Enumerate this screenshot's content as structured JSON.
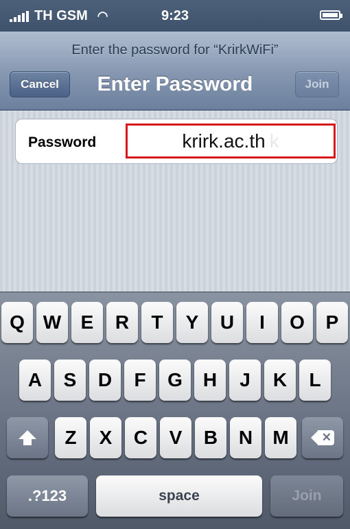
{
  "status_bar": {
    "carrier": "TH GSM",
    "time": "9:23",
    "signal_icon": "signal-bars-icon",
    "wifi_icon": "wifi-icon",
    "battery_icon": "battery-icon",
    "battery_level": 1.0
  },
  "nav": {
    "prompt": "Enter the password for “KrirkWiFi”",
    "title": "Enter Password",
    "cancel_label": "Cancel",
    "join_label": "Join"
  },
  "password_field": {
    "label": "Password",
    "value": "krirk.ac.th",
    "ghost_char": "k",
    "highlight_color": "#d6171c"
  },
  "keyboard": {
    "row1": [
      "Q",
      "W",
      "E",
      "R",
      "T",
      "Y",
      "U",
      "I",
      "O",
      "P"
    ],
    "row2": [
      "A",
      "S",
      "D",
      "F",
      "G",
      "H",
      "J",
      "K",
      "L"
    ],
    "row3": [
      "Z",
      "X",
      "C",
      "V",
      "B",
      "N",
      "M"
    ],
    "shift_icon": "shift-icon",
    "delete_icon": "delete-backspace-icon",
    "numbers_label": ".?123",
    "space_label": "space",
    "join_label": "Join"
  }
}
